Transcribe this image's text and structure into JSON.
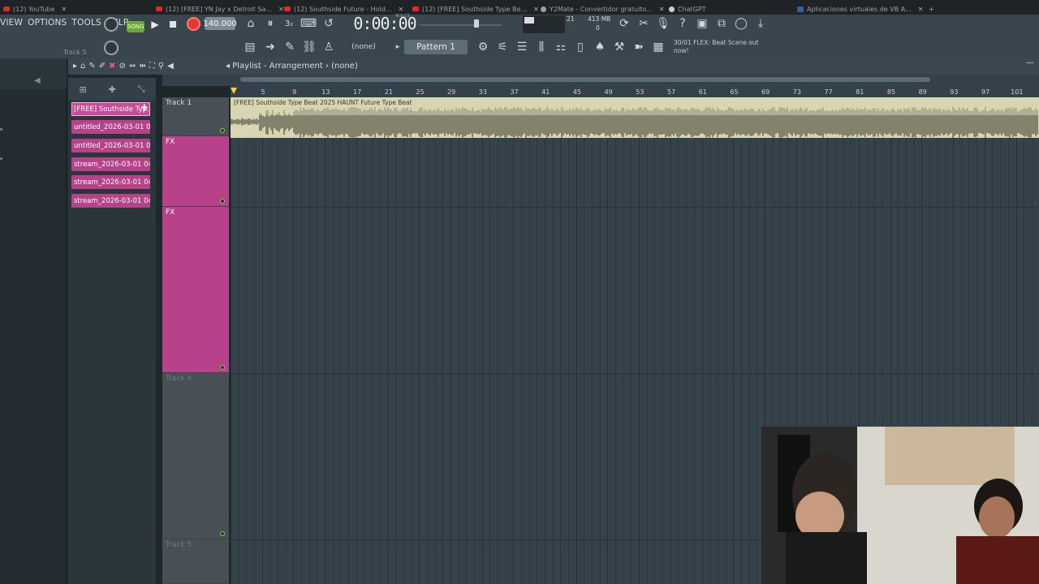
{
  "browser": {
    "tabs": [
      {
        "label": "(12) YouTube",
        "icon": "youtube-icon"
      },
      {
        "label": "(12) [FREE] YN Jay x Detroit Sa...",
        "icon": "youtube-icon"
      },
      {
        "label": "(12) Southside Future - Hold...",
        "icon": "youtube-icon"
      },
      {
        "label": "(12) [FREE] Southside Type Be...",
        "icon": "youtube-icon"
      },
      {
        "label": "Y2Mate - Convertidor gratuito...",
        "icon": "y2mate-icon"
      },
      {
        "label": "ChatGPT",
        "icon": "chatgpt-icon"
      },
      {
        "label": "Aplicaciones virtuales de VB A...",
        "icon": "vb-icon"
      }
    ]
  },
  "menu": {
    "items": [
      "VIEW",
      "OPTIONS",
      "TOOLS",
      "HELP"
    ],
    "track_hint": "Track 5"
  },
  "transport": {
    "song_label": "SONG",
    "tempo": "140.000",
    "time": "0:00:00",
    "time_unit": "M:S:CS",
    "cpu_value": "21",
    "mem_value": "413 MB",
    "poly_value": "0"
  },
  "toolbar2": {
    "snap_value": "(none)",
    "pattern": "Pattern 1",
    "news": "30/01  FLEX: Beat Scene out now!"
  },
  "playlist": {
    "title": "Playlist - Arrangement",
    "breadcrumb": "(none)",
    "ruler": [
      "5",
      "9",
      "13",
      "17",
      "21",
      "25",
      "29",
      "33",
      "37",
      "41",
      "45",
      "49",
      "53",
      "57",
      "61",
      "65",
      "69",
      "73",
      "77",
      "81",
      "85",
      "89",
      "93",
      "97",
      "101"
    ],
    "tracks": [
      {
        "name": "Track 1"
      },
      {
        "name": "FX"
      },
      {
        "name": "FX"
      },
      {
        "name": "Track 4"
      },
      {
        "name": "Track 5"
      }
    ],
    "audio_clip_label": "[FREE] Southside Type Beat 2025 HAUNT Future Type Beat"
  },
  "picker": {
    "clips": [
      "[FREE] Southside Typ...",
      "untitled_2026-03-01 04-...",
      "untitled_2026-03-01 04-...",
      "stream_2026-03-01 04-...",
      "stream_2026-03-01 04-...",
      "stream_2026-03-01 04-..."
    ]
  }
}
